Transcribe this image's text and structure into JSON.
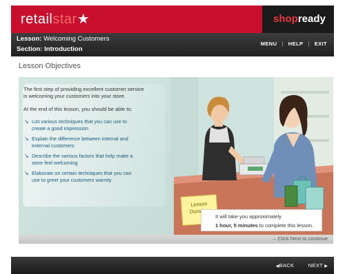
{
  "header": {
    "logo_main": "retail",
    "logo_accent": "star",
    "logo_star": "★",
    "brand_shop": "shop",
    "brand_ready": "ready"
  },
  "lesson": {
    "lesson_label": "Lesson:",
    "lesson_value": "Welcoming Customers",
    "section_label": "Section:",
    "section_value": "Introduction"
  },
  "topnav": {
    "menu": "MENU",
    "help": "HELP",
    "exit": "EXIT",
    "separator": "|"
  },
  "page_title": "Lesson Objectives",
  "content": {
    "intro_line1": "The first step of providing excellent customer service",
    "intro_line2": "is welcoming your customers into your store.",
    "intro_line3": "At the end of this lesson, you should be able to:",
    "objectives": [
      {
        "line1": "List various techniques that you can use to",
        "line2": "create a good impression"
      },
      {
        "line1": "Explain the difference between internal and",
        "line2": "external customers"
      },
      {
        "line1": "Describe the various factors that help make a",
        "line2": "store feel welcoming"
      },
      {
        "line1": "Elaborate on certain techniques that you can",
        "line2": "use to greet your customers warmly"
      }
    ]
  },
  "duration": {
    "note_line1": "Lesson",
    "note_line2": "Duration",
    "text_line1": "It will take you approximately",
    "text_bold": "1 hour, 5 minutes",
    "text_tail": " to complete this lesson."
  },
  "continue_hint": "→ Click Next to continue",
  "footer": {
    "back_label": "BACK",
    "next_label": "NEXT",
    "back_arrow": "◀",
    "next_arrow": "▶"
  },
  "colors": {
    "brand_red": "#c8102e",
    "panel_teal": "#cfe3df",
    "link_blue": "#1a5a7a"
  }
}
